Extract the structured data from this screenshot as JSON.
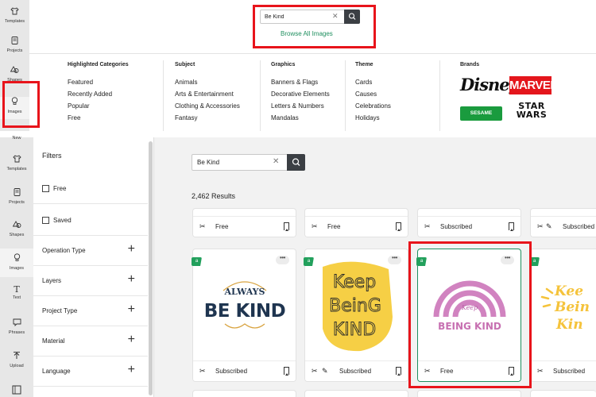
{
  "top_rail": [
    {
      "label": "Templates",
      "icon": "shirt-icon"
    },
    {
      "label": "Projects",
      "icon": "projects-icon"
    },
    {
      "label": "Shapes",
      "icon": "shapes-icon"
    },
    {
      "label": "Images",
      "icon": "lightbulb-icon"
    }
  ],
  "top_search": {
    "value": "Be Kind",
    "placeholder": ""
  },
  "browse_all": "Browse All Images",
  "categories": {
    "highlighted": {
      "title": "Highlighted Categories",
      "items": [
        "Featured",
        "Recently Added",
        "Popular",
        "Free"
      ]
    },
    "subject": {
      "title": "Subject",
      "items": [
        "Animals",
        "Arts & Entertainment",
        "Clothing & Accessories",
        "Fantasy"
      ]
    },
    "graphics": {
      "title": "Graphics",
      "items": [
        "Banners & Flags",
        "Decorative Elements",
        "Letters & Numbers",
        "Mandalas"
      ]
    },
    "theme": {
      "title": "Theme",
      "items": [
        "Cards",
        "Causes",
        "Celebrations",
        "Holidays"
      ]
    },
    "brands": {
      "title": "Brands",
      "logos": [
        "Disney",
        "MARVEL",
        "SESAME STREET",
        "STAR WARS"
      ]
    }
  },
  "bottom_rail": [
    {
      "label": "New",
      "icon": "new-icon"
    },
    {
      "label": "Templates",
      "icon": "shirt-icon"
    },
    {
      "label": "Projects",
      "icon": "projects-icon"
    },
    {
      "label": "Shapes",
      "icon": "shapes-icon"
    },
    {
      "label": "Images",
      "icon": "lightbulb-icon"
    },
    {
      "label": "Text",
      "icon": "text-icon"
    },
    {
      "label": "Phrases",
      "icon": "phrases-icon"
    },
    {
      "label": "Upload",
      "icon": "upload-icon"
    }
  ],
  "filters": {
    "title": "Filters",
    "checkboxes": [
      "Free",
      "Saved"
    ],
    "groups": [
      "Operation Type",
      "Layers",
      "Project Type",
      "Material",
      "Language"
    ]
  },
  "search": {
    "value": "Be Kind",
    "placeholder": ""
  },
  "results_count": "2,462 Results",
  "row1_cards": [
    {
      "access": "Free"
    },
    {
      "access": "Free"
    },
    {
      "access": "Subscribed"
    },
    {
      "access": "Subscribed"
    }
  ],
  "row2_cards": [
    {
      "access": "Subscribed",
      "art": [
        "ALWAYS",
        "BE KIND"
      ]
    },
    {
      "access": "Subscribed",
      "art": [
        "Keep",
        "BeinG",
        "KIND"
      ]
    },
    {
      "access": "Free",
      "art": [
        "Keep",
        "BEING KIND"
      ]
    },
    {
      "access": "Subscribed",
      "art": [
        "Kee",
        "Bein",
        "Kin"
      ]
    }
  ],
  "colors": {
    "accent": "#1f8f5f",
    "highlight": "#e8141b",
    "search_btn": "#3b3f44",
    "free_tag": "#22a05c"
  }
}
